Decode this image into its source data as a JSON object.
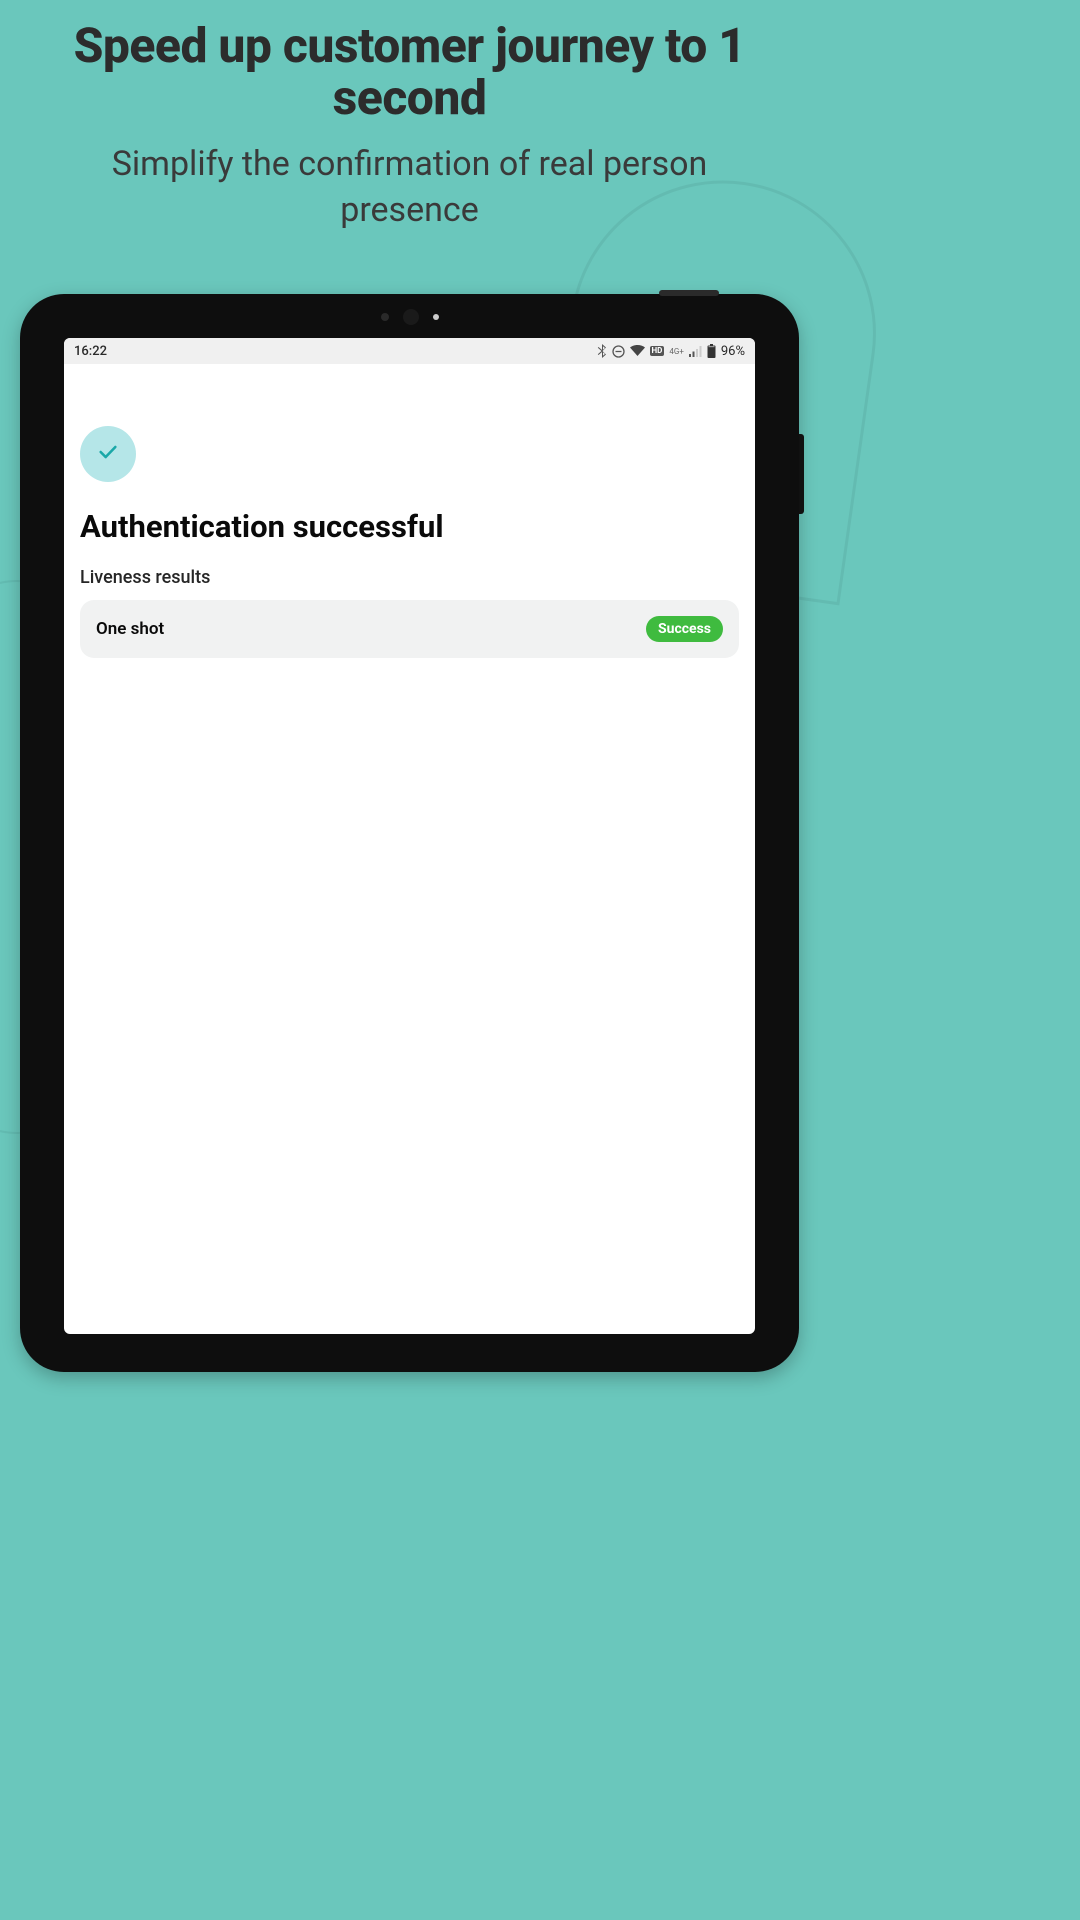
{
  "hero": {
    "title": "Speed up customer journey to 1 second",
    "subtitle": "Simplify the confirmation of real person presence"
  },
  "statusBar": {
    "time": "16:22",
    "battery": "96%",
    "network": "4G+"
  },
  "screen": {
    "title": "Authentication successful",
    "sectionLabel": "Liveness results",
    "result": {
      "name": "One shot",
      "status": "Success"
    }
  }
}
